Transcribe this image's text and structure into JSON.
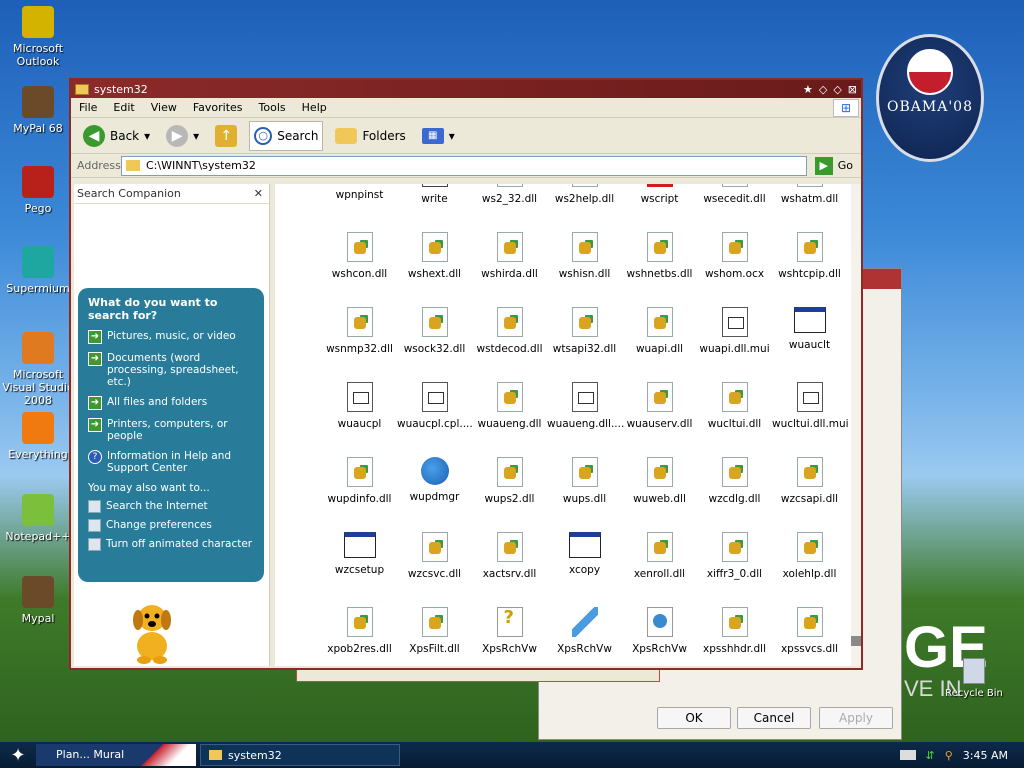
{
  "desktop": {
    "icons": [
      {
        "label": "Microsoft Outlook",
        "icon": "outlook-icon",
        "color": "#d4b200"
      },
      {
        "label": "MyPal 68",
        "icon": "mypal-icon",
        "color": "#6b4a2a"
      },
      {
        "label": "Pego",
        "icon": "pego-icon",
        "color": "#b8201a"
      },
      {
        "label": "Supermium",
        "icon": "supermium-icon",
        "color": "#1da7a0"
      },
      {
        "label": "Microsoft Visual Studio 2008",
        "icon": "visual-studio-icon",
        "color": "#e07a20"
      },
      {
        "label": "Everything",
        "icon": "everything-icon",
        "color": "#f07a10"
      },
      {
        "label": "Notepad++",
        "icon": "notepadpp-icon",
        "color": "#7cbf3a"
      },
      {
        "label": "Mypal",
        "icon": "mypal-icon",
        "color": "#6b4a2a"
      }
    ],
    "recycle_bin": "Recycle Bin",
    "obama_logo_text": "OBAMA'08",
    "bg_text_big": "GE",
    "bg_text_small": "VE IN"
  },
  "background_dialog": {
    "ok_label": "OK",
    "cancel_label": "Cancel",
    "apply_label": "Apply"
  },
  "window": {
    "title": "system32",
    "accent": "#8c2a2a",
    "menu": [
      "File",
      "Edit",
      "View",
      "Favorites",
      "Tools",
      "Help"
    ],
    "toolbar": {
      "back_label": "Back",
      "search_label": "Search",
      "folders_label": "Folders"
    },
    "address": {
      "label": "Address",
      "value": "C:\\WINNT\\system32",
      "go_label": "Go"
    }
  },
  "search_companion": {
    "title": "Search Companion",
    "question": "What do you want to search for?",
    "options": [
      "Pictures, music, or video",
      "Documents (word processing, spreadsheet, etc.)",
      "All files and folders",
      "Printers, computers, or people"
    ],
    "help_option": "Information in Help and Support Center",
    "also_label": "You may also want to...",
    "secondary_options": [
      "Search the Internet",
      "Change preferences",
      "Turn off animated character"
    ]
  },
  "files": [
    {
      "name": "wpnpinst",
      "type": "app"
    },
    {
      "name": "write",
      "type": "notepad"
    },
    {
      "name": "ws2_32.dll",
      "type": "dll"
    },
    {
      "name": "ws2help.dll",
      "type": "dll"
    },
    {
      "name": "wscript",
      "type": "redicon"
    },
    {
      "name": "wsecedit.dll",
      "type": "dll"
    },
    {
      "name": "wshatm.dll",
      "type": "dll"
    },
    {
      "name": "wshcon.dll",
      "type": "dll"
    },
    {
      "name": "wshext.dll",
      "type": "dll"
    },
    {
      "name": "wshirda.dll",
      "type": "dll"
    },
    {
      "name": "wshisn.dll",
      "type": "dll"
    },
    {
      "name": "wshnetbs.dll",
      "type": "dll"
    },
    {
      "name": "wshom.ocx",
      "type": "dll"
    },
    {
      "name": "wshtcpip.dll",
      "type": "dll"
    },
    {
      "name": "wsnmp32.dll",
      "type": "dll"
    },
    {
      "name": "wsock32.dll",
      "type": "dll"
    },
    {
      "name": "wstdecod.dll",
      "type": "dll"
    },
    {
      "name": "wtsapi32.dll",
      "type": "dll"
    },
    {
      "name": "wuapi.dll",
      "type": "dll"
    },
    {
      "name": "wuapi.dll.mui",
      "type": "doc"
    },
    {
      "name": "wuauclt",
      "type": "app"
    },
    {
      "name": "wuaucpl",
      "type": "doc"
    },
    {
      "name": "wuaucpl.cpl....",
      "type": "doc"
    },
    {
      "name": "wuaueng.dll",
      "type": "dll"
    },
    {
      "name": "wuaueng.dll....",
      "type": "doc"
    },
    {
      "name": "wuauserv.dll",
      "type": "dll"
    },
    {
      "name": "wucltui.dll",
      "type": "dll"
    },
    {
      "name": "wucltui.dll.mui",
      "type": "doc"
    },
    {
      "name": "wupdinfo.dll",
      "type": "dll"
    },
    {
      "name": "wupdmgr",
      "type": "globe"
    },
    {
      "name": "wups2.dll",
      "type": "dll"
    },
    {
      "name": "wups.dll",
      "type": "dll"
    },
    {
      "name": "wuweb.dll",
      "type": "dll"
    },
    {
      "name": "wzcdlg.dll",
      "type": "dll"
    },
    {
      "name": "wzcsapi.dll",
      "type": "dll"
    },
    {
      "name": "wzcsetup",
      "type": "app"
    },
    {
      "name": "wzcsvc.dll",
      "type": "dll"
    },
    {
      "name": "xactsrv.dll",
      "type": "dll"
    },
    {
      "name": "xcopy",
      "type": "app"
    },
    {
      "name": "xenroll.dll",
      "type": "dll"
    },
    {
      "name": "xiffr3_0.dll",
      "type": "dll"
    },
    {
      "name": "xolehlp.dll",
      "type": "dll"
    },
    {
      "name": "xpob2res.dll",
      "type": "dll"
    },
    {
      "name": "XpsFilt.dll",
      "type": "dll"
    },
    {
      "name": "XpsRchVw",
      "type": "help"
    },
    {
      "name": "XpsRchVw",
      "type": "plane"
    },
    {
      "name": "XpsRchVw",
      "type": "html"
    },
    {
      "name": "xpsshhdr.dll",
      "type": "dll"
    },
    {
      "name": "xpssvcs.dll",
      "type": "dll"
    }
  ],
  "taskbar": {
    "tasks": [
      {
        "label": "Plan... Mural"
      },
      {
        "label": "system32"
      }
    ],
    "clock": "3:45 AM"
  }
}
